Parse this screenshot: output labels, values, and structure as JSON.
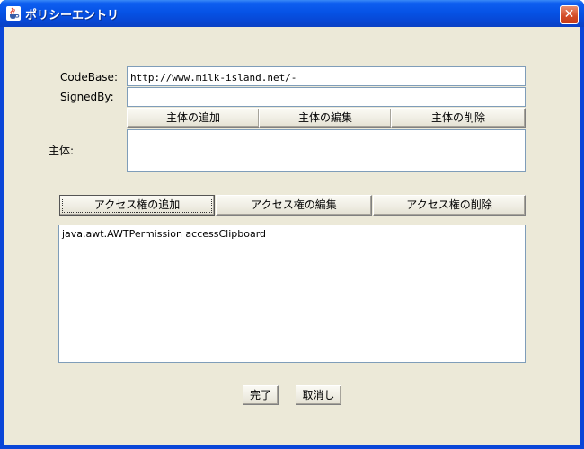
{
  "window": {
    "title": "ポリシーエントリ",
    "close_symbol": "✕"
  },
  "form": {
    "codebase": {
      "label": "CodeBase:",
      "value": "http://www.milk-island.net/-"
    },
    "signedby": {
      "label": "SignedBy:",
      "value": ""
    },
    "principal_buttons": [
      "主体の追加",
      "主体の編集",
      "主体の削除"
    ],
    "principal_label": "主体:",
    "permission_buttons": [
      "アクセス権の追加",
      "アクセス権の編集",
      "アクセス権の削除"
    ],
    "permissions": [
      "java.awt.AWTPermission accessClipboard"
    ]
  },
  "footer": {
    "done_label": "完了",
    "cancel_label": "取消し"
  }
}
